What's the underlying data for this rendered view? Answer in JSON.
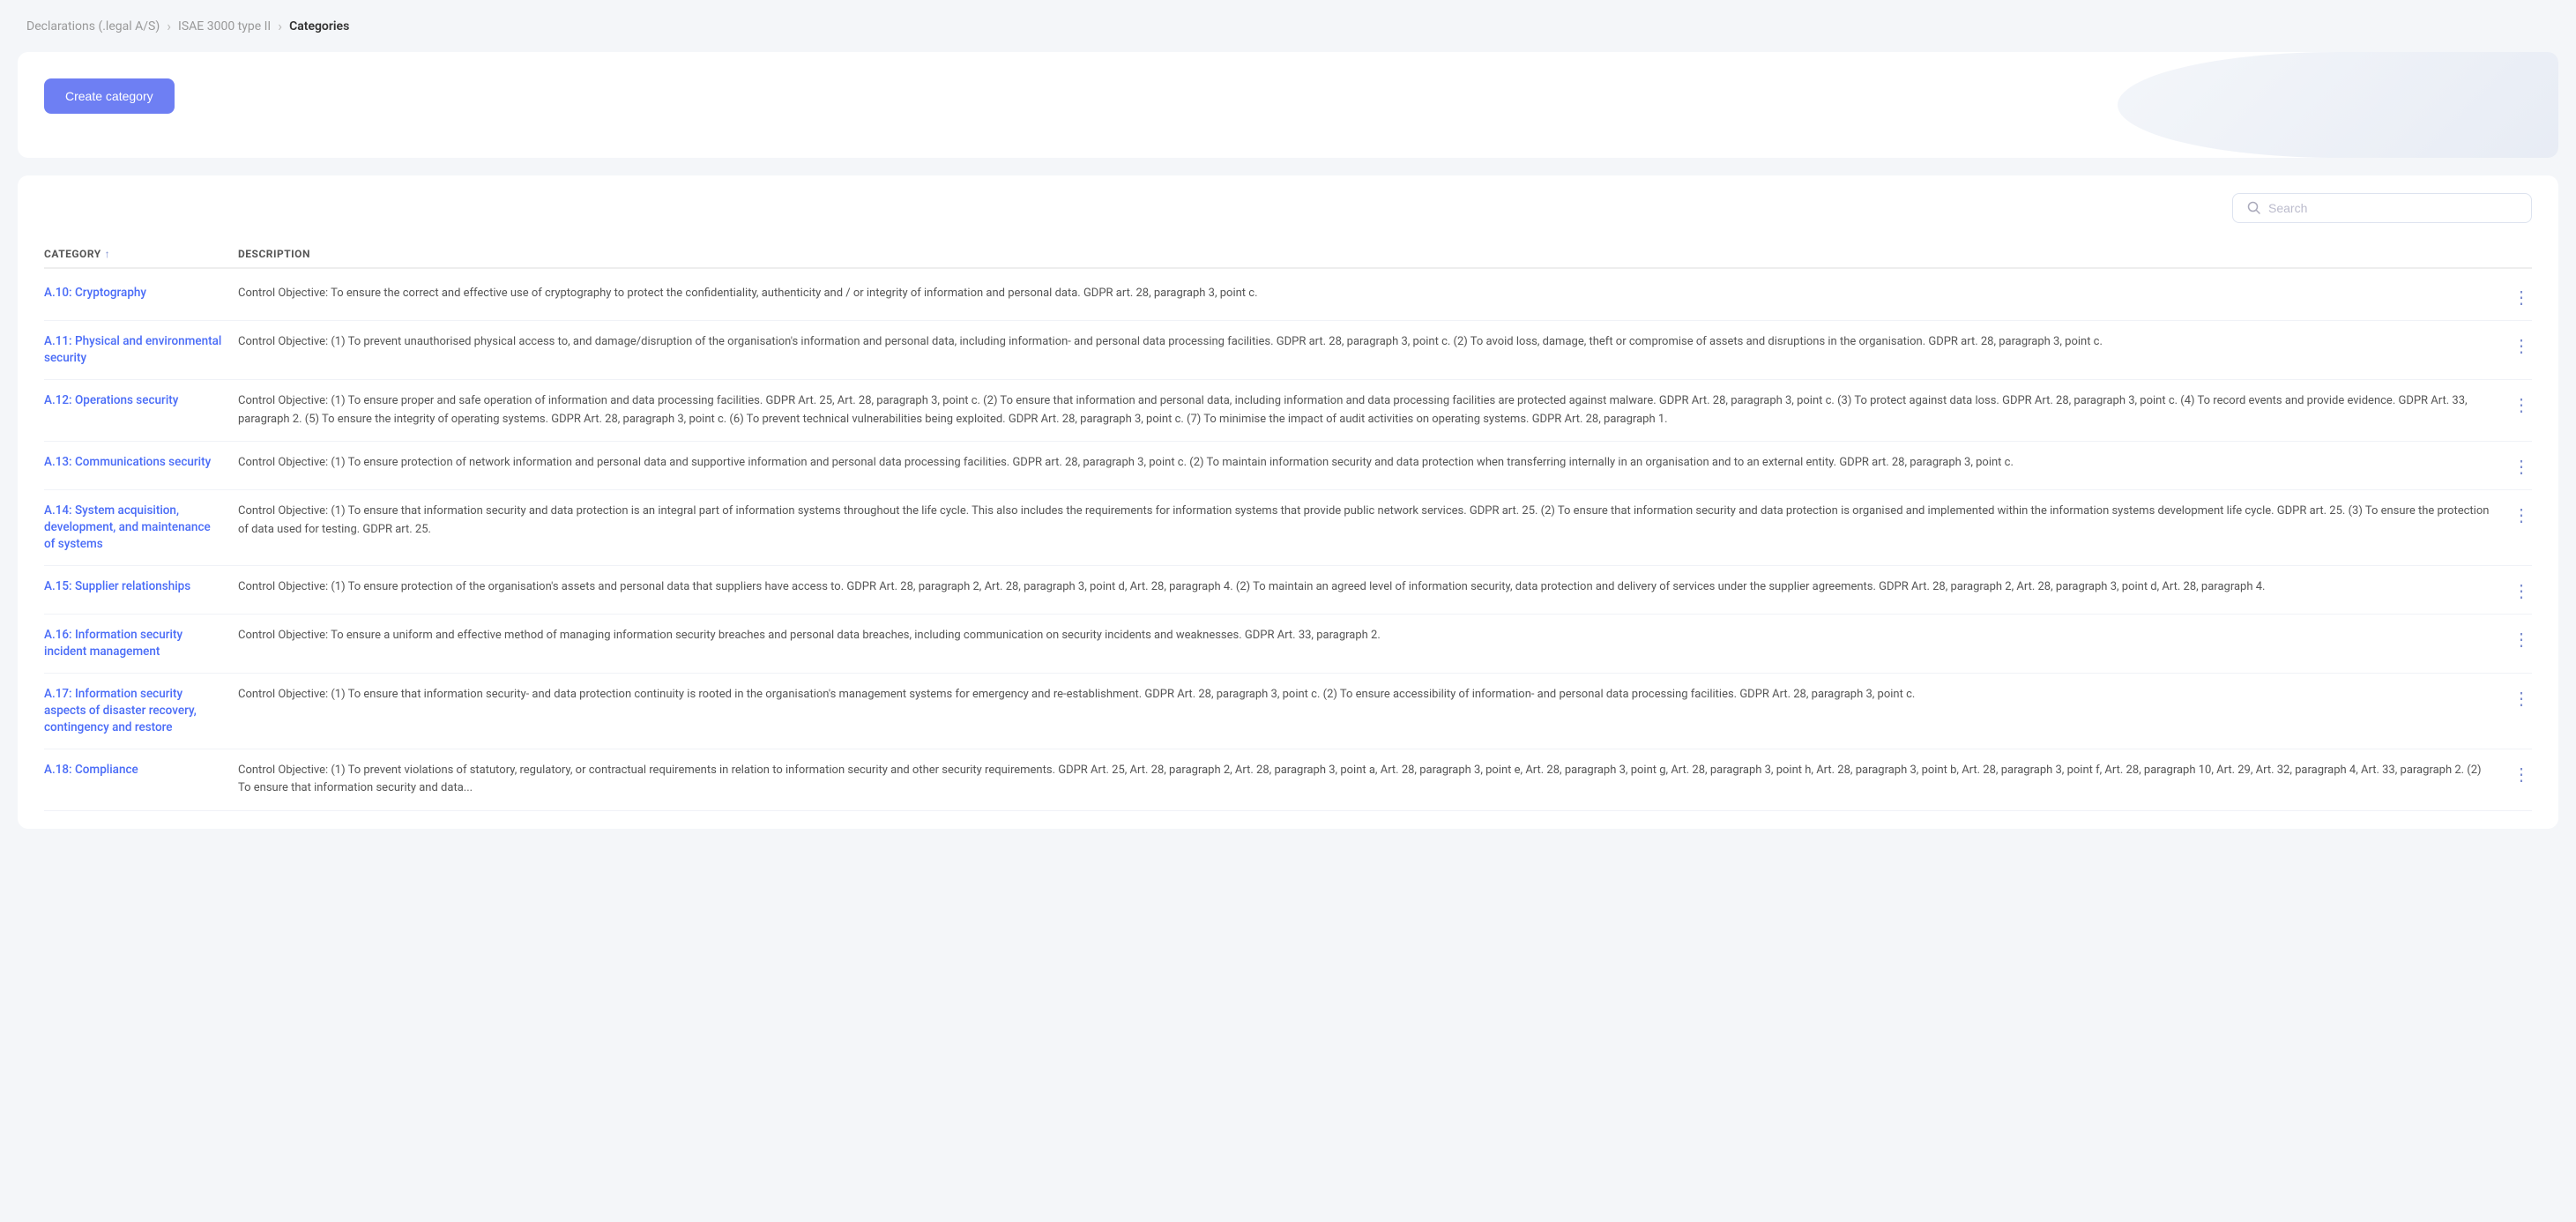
{
  "breadcrumb": {
    "items": [
      {
        "label": "Declarations (.legal A/S)",
        "active": false
      },
      {
        "label": "ISAE 3000 type II",
        "active": false
      },
      {
        "label": "Categories",
        "active": true
      }
    ]
  },
  "header": {
    "create_button_label": "Create category"
  },
  "search": {
    "placeholder": "Search"
  },
  "table": {
    "columns": [
      {
        "label": "CATEGORY",
        "sort": "asc"
      },
      {
        "label": "DESCRIPTION"
      }
    ],
    "rows": [
      {
        "category": "A.10: Cryptography",
        "description": "Control Objective: To ensure the correct and effective use of cryptography to protect the confidentiality, authenticity and / or integrity of information and personal data. GDPR art. 28, paragraph 3, point c."
      },
      {
        "category": "A.11: Physical and environmental security",
        "description": "Control Objective: (1) To prevent unauthorised physical access to, and damage/disruption of the organisation's information and personal data, including information- and personal data processing facilities. GDPR art. 28, paragraph 3, point c. (2) To avoid loss, damage, theft or compromise of assets and disruptions in the organisation. GDPR art. 28, paragraph 3, point c."
      },
      {
        "category": "A.12: Operations security",
        "description": "Control Objective: (1) To ensure proper and safe operation of information and data processing facilities. GDPR Art. 25, Art. 28, paragraph 3, point c. (2) To ensure that information and personal data, including information and data processing facilities are protected against malware. GDPR Art. 28, paragraph 3, point c. (3) To protect against data loss. GDPR Art. 28, paragraph 3, point c. (4) To record events and provide evidence. GDPR Art. 33, paragraph 2. (5) To ensure the integrity of operating systems. GDPR Art. 28, paragraph 3, point c. (6) To prevent technical vulnerabilities being exploited. GDPR Art. 28, paragraph 3, point c. (7) To minimise the impact of audit activities on operating systems. GDPR Art. 28, paragraph 1."
      },
      {
        "category": "A.13: Communications security",
        "description": "Control Objective: (1) To ensure protection of network information and personal data and supportive information and personal data processing facilities. GDPR art. 28, paragraph 3, point c. (2) To maintain information security and data protection when transferring internally in an organisation and to an external entity. GDPR art. 28, paragraph 3, point c."
      },
      {
        "category": "A.14: System acquisition, development, and maintenance of systems",
        "description": "Control Objective: (1) To ensure that information security and data protection is an integral part of information systems throughout the life cycle. This also includes the requirements for information systems that provide public network services. GDPR art. 25. (2) To ensure that information security and data protection is organised and implemented within the information systems development life cycle. GDPR art. 25. (3) To ensure the protection of data used for testing. GDPR art. 25."
      },
      {
        "category": "A.15: Supplier relationships",
        "description": "Control Objective: (1) To ensure protection of the organisation's assets and personal data that suppliers have access to. GDPR Art. 28, paragraph 2, Art. 28, paragraph 3, point d, Art. 28, paragraph 4. (2) To maintain an agreed level of information security, data protection and delivery of services under the supplier agreements. GDPR Art. 28, paragraph 2, Art. 28, paragraph 3, point d, Art. 28, paragraph 4."
      },
      {
        "category": "A.16: Information security incident management",
        "description": "Control Objective: To ensure a uniform and effective method of managing information security breaches and personal data breaches, including communication on security incidents and weaknesses. GDPR Art. 33, paragraph 2."
      },
      {
        "category": "A.17: Information security aspects of disaster recovery, contingency and restore",
        "description": "Control Objective: (1) To ensure that information security- and data protection continuity is rooted in the organisation's management systems for emergency and re-establishment. GDPR Art. 28, paragraph 3, point c. (2) To ensure accessibility of information- and personal data processing facilities. GDPR Art. 28, paragraph 3, point c."
      },
      {
        "category": "A.18: Compliance",
        "description": "Control Objective: (1) To prevent violations of statutory, regulatory, or contractual requirements in relation to information security and other security requirements. GDPR Art. 25, Art. 28, paragraph 2, Art. 28, paragraph 3, point a, Art. 28, paragraph 3, point e, Art. 28, paragraph 3, point g, Art. 28, paragraph 3, point h, Art. 28, paragraph 3, point b, Art. 28, paragraph 3, point f, Art. 28, paragraph 10, Art. 29, Art. 32, paragraph 4, Art. 33, paragraph 2. (2) To ensure that information security and data..."
      }
    ]
  }
}
